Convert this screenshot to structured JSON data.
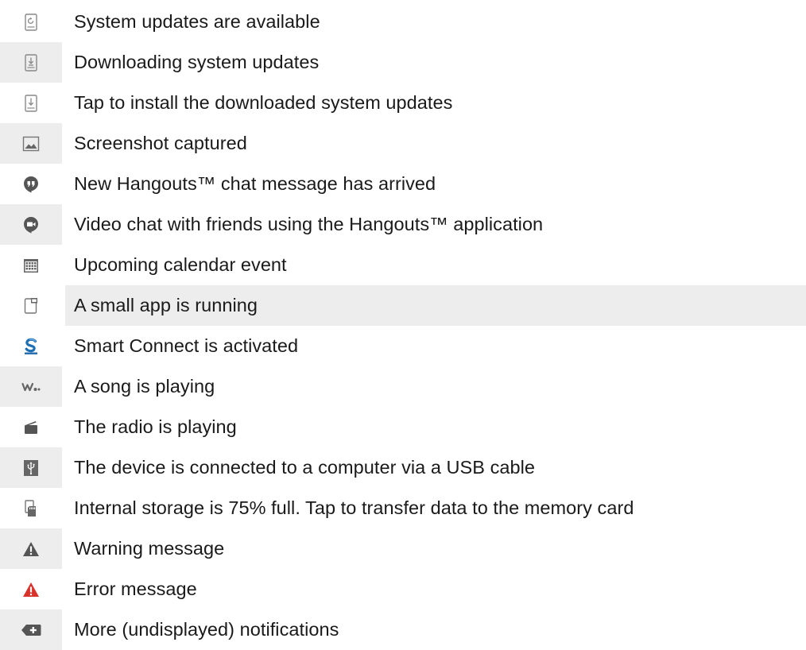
{
  "rows": [
    {
      "icon": "system-update-icon",
      "text": "System updates are available",
      "shade_icon": false,
      "shade_text": false
    },
    {
      "icon": "downloading-update-icon",
      "text": "Downloading system updates",
      "shade_icon": true,
      "shade_text": false
    },
    {
      "icon": "install-update-icon",
      "text": "Tap to install the downloaded system updates",
      "shade_icon": false,
      "shade_text": false
    },
    {
      "icon": "screenshot-icon",
      "text": "Screenshot captured",
      "shade_icon": true,
      "shade_text": false
    },
    {
      "icon": "hangouts-chat-icon",
      "text": "New Hangouts™ chat message has arrived",
      "shade_icon": false,
      "shade_text": false
    },
    {
      "icon": "hangouts-video-icon",
      "text": "Video chat with friends using the Hangouts™ application",
      "shade_icon": true,
      "shade_text": false
    },
    {
      "icon": "calendar-icon",
      "text": "Upcoming calendar event",
      "shade_icon": false,
      "shade_text": false
    },
    {
      "icon": "small-app-icon",
      "text": "A small app is running",
      "shade_icon": false,
      "shade_text": true
    },
    {
      "icon": "smart-connect-icon",
      "text": "Smart Connect is activated",
      "shade_icon": false,
      "shade_text": false
    },
    {
      "icon": "walkman-icon",
      "text": "A song is playing",
      "shade_icon": true,
      "shade_text": false
    },
    {
      "icon": "radio-icon",
      "text": "The radio is playing",
      "shade_icon": false,
      "shade_text": false
    },
    {
      "icon": "usb-icon",
      "text": "The device is connected to a computer via a USB cable",
      "shade_icon": true,
      "shade_text": false
    },
    {
      "icon": "storage-icon",
      "text": "Internal storage is 75% full. Tap to transfer data to the memory card",
      "shade_icon": false,
      "shade_text": false
    },
    {
      "icon": "warning-icon",
      "text": "Warning message",
      "shade_icon": true,
      "shade_text": false
    },
    {
      "icon": "error-icon",
      "text": "Error message",
      "shade_icon": false,
      "shade_text": false
    },
    {
      "icon": "more-notifications-icon",
      "text": "More (undisplayed) notifications",
      "shade_icon": true,
      "shade_text": false
    }
  ],
  "colors": {
    "shade": "#ededee",
    "icon_gray": "#8a8a8a",
    "icon_dark": "#555555",
    "smart_connect_blue": "#1f6fb5",
    "error_red": "#d9322b",
    "text": "#1a1a1a"
  }
}
